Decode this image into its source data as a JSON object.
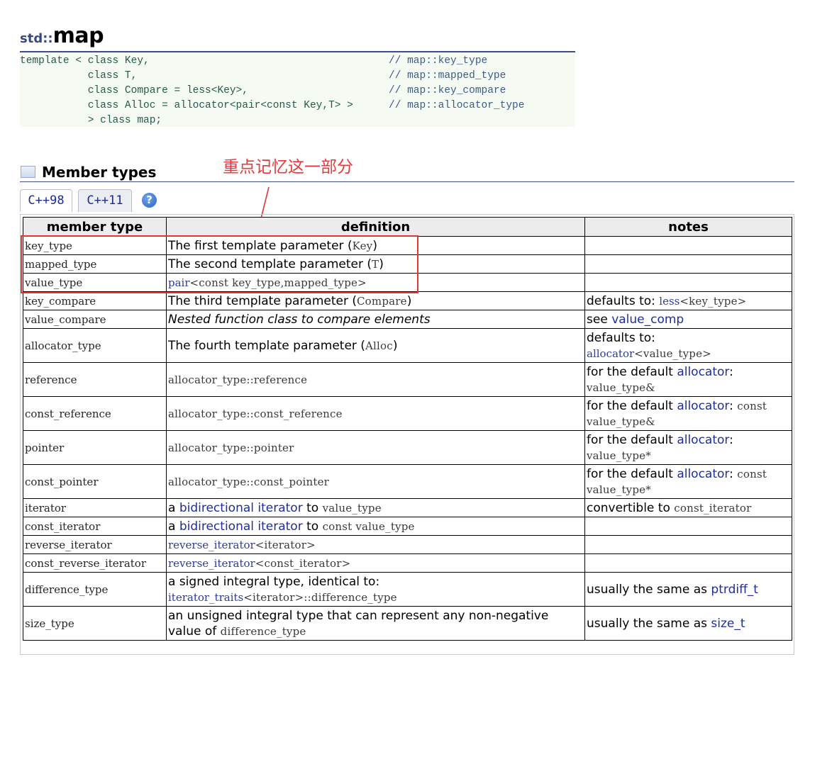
{
  "title": {
    "namespace": "std::",
    "name": "map"
  },
  "prototype": {
    "lines": [
      {
        "code": "template < class Key,",
        "comment": "// map::key_type"
      },
      {
        "code": "           class T,",
        "comment": "// map::mapped_type"
      },
      {
        "code": "           class Compare = less<Key>,",
        "comment": "// map::key_compare"
      },
      {
        "code": "           class Alloc = allocator<pair<const Key,T> >",
        "comment": "// map::allocator_type"
      },
      {
        "code": "           > class map;",
        "comment": ""
      }
    ]
  },
  "section": {
    "title": "Member types",
    "annotation": "重点记忆这一部分"
  },
  "tabs": [
    {
      "label": "C++98"
    },
    {
      "label": "C++11"
    }
  ],
  "help_label": "?",
  "table": {
    "headers": [
      "member type",
      "definition",
      "notes"
    ],
    "rows": [
      {
        "type": "key_type",
        "def_parts": [
          {
            "t": "The first template parameter (",
            "s": "txt"
          },
          {
            "t": "Key",
            "s": "mono"
          },
          {
            "t": ")",
            "s": "txt"
          }
        ],
        "note_parts": []
      },
      {
        "type": "mapped_type",
        "def_parts": [
          {
            "t": "The second template parameter (",
            "s": "txt"
          },
          {
            "t": "T",
            "s": "mono"
          },
          {
            "t": ")",
            "s": "txt"
          }
        ],
        "note_parts": []
      },
      {
        "type": "value_type",
        "def_parts": [
          {
            "t": "pair",
            "s": "lkm"
          },
          {
            "t": "<const key_type,mapped_type>",
            "s": "mono"
          }
        ],
        "note_parts": []
      },
      {
        "type": "key_compare",
        "def_parts": [
          {
            "t": "The third template parameter (",
            "s": "txt"
          },
          {
            "t": "Compare",
            "s": "mono"
          },
          {
            "t": ")",
            "s": "txt"
          }
        ],
        "note_parts": [
          {
            "t": "defaults to: ",
            "s": "txt"
          },
          {
            "t": "less",
            "s": "lkm"
          },
          {
            "t": "<key_type>",
            "s": "mono"
          }
        ]
      },
      {
        "type": "value_compare",
        "def_parts": [
          {
            "t": "Nested function class to compare elements",
            "s": "it"
          }
        ],
        "note_parts": [
          {
            "t": "see ",
            "s": "txt"
          },
          {
            "t": "value_comp",
            "s": "lk"
          }
        ]
      },
      {
        "type": "allocator_type",
        "def_parts": [
          {
            "t": "The fourth template parameter (",
            "s": "txt"
          },
          {
            "t": "Alloc",
            "s": "mono"
          },
          {
            "t": ")",
            "s": "txt"
          }
        ],
        "note_parts": [
          {
            "t": "defaults to:",
            "s": "txt"
          },
          {
            "t": "",
            "s": "br"
          },
          {
            "t": "allocator",
            "s": "lkm"
          },
          {
            "t": "<value_type>",
            "s": "mono"
          }
        ]
      },
      {
        "type": "reference",
        "def_parts": [
          {
            "t": "allocator_type::reference",
            "s": "mono"
          }
        ],
        "note_parts": [
          {
            "t": "for the default ",
            "s": "txt"
          },
          {
            "t": "allocator",
            "s": "lk"
          },
          {
            "t": ":",
            "s": "txt"
          },
          {
            "t": "",
            "s": "br"
          },
          {
            "t": "value_type&",
            "s": "mono"
          }
        ]
      },
      {
        "type": "const_reference",
        "def_parts": [
          {
            "t": "allocator_type::const_reference",
            "s": "mono"
          }
        ],
        "note_parts": [
          {
            "t": "for the default ",
            "s": "txt"
          },
          {
            "t": "allocator",
            "s": "lk"
          },
          {
            "t": ": ",
            "s": "txt"
          },
          {
            "t": "const",
            "s": "mono"
          },
          {
            "t": "",
            "s": "br"
          },
          {
            "t": "value_type&",
            "s": "mono"
          }
        ]
      },
      {
        "type": "pointer",
        "def_parts": [
          {
            "t": "allocator_type::pointer",
            "s": "mono"
          }
        ],
        "note_parts": [
          {
            "t": "for the default ",
            "s": "txt"
          },
          {
            "t": "allocator",
            "s": "lk"
          },
          {
            "t": ":",
            "s": "txt"
          },
          {
            "t": "",
            "s": "br"
          },
          {
            "t": "value_type*",
            "s": "mono"
          }
        ]
      },
      {
        "type": "const_pointer",
        "def_parts": [
          {
            "t": "allocator_type::const_pointer",
            "s": "mono"
          }
        ],
        "note_parts": [
          {
            "t": "for the default ",
            "s": "txt"
          },
          {
            "t": "allocator",
            "s": "lk"
          },
          {
            "t": ": ",
            "s": "txt"
          },
          {
            "t": "const",
            "s": "mono"
          },
          {
            "t": "",
            "s": "br"
          },
          {
            "t": "value_type*",
            "s": "mono"
          }
        ]
      },
      {
        "type": "iterator",
        "def_parts": [
          {
            "t": "a ",
            "s": "txt"
          },
          {
            "t": "bidirectional iterator",
            "s": "lk"
          },
          {
            "t": " to ",
            "s": "txt"
          },
          {
            "t": "value_type",
            "s": "mono"
          }
        ],
        "note_parts": [
          {
            "t": "convertible to ",
            "s": "txt"
          },
          {
            "t": "const_iterator",
            "s": "mono"
          }
        ]
      },
      {
        "type": "const_iterator",
        "def_parts": [
          {
            "t": "a ",
            "s": "txt"
          },
          {
            "t": "bidirectional iterator",
            "s": "lk"
          },
          {
            "t": " to ",
            "s": "txt"
          },
          {
            "t": "const value_type",
            "s": "mono"
          }
        ],
        "note_parts": []
      },
      {
        "type": "reverse_iterator",
        "def_parts": [
          {
            "t": "reverse_iterator",
            "s": "lkm"
          },
          {
            "t": "<iterator>",
            "s": "mono"
          }
        ],
        "note_parts": []
      },
      {
        "type": "const_reverse_iterator",
        "def_parts": [
          {
            "t": "reverse_iterator",
            "s": "lkm"
          },
          {
            "t": "<const_iterator>",
            "s": "mono"
          }
        ],
        "note_parts": []
      },
      {
        "type": "difference_type",
        "def_parts": [
          {
            "t": "a signed integral type, identical to:",
            "s": "txt"
          },
          {
            "t": "",
            "s": "br"
          },
          {
            "t": "iterator_traits",
            "s": "lkm"
          },
          {
            "t": "<iterator>::difference_type",
            "s": "mono"
          }
        ],
        "note_parts": [
          {
            "t": "usually the same as ",
            "s": "txt"
          },
          {
            "t": "ptrdiff_t",
            "s": "lk"
          }
        ]
      },
      {
        "type": "size_type",
        "def_parts": [
          {
            "t": "an unsigned integral type that can represent any non-negative",
            "s": "txt"
          },
          {
            "t": "",
            "s": "br"
          },
          {
            "t": "value of ",
            "s": "txt"
          },
          {
            "t": "difference_type",
            "s": "mono"
          }
        ],
        "note_parts": [
          {
            "t": "usually the same as ",
            "s": "txt"
          },
          {
            "t": "size_t",
            "s": "lk"
          }
        ]
      }
    ]
  }
}
